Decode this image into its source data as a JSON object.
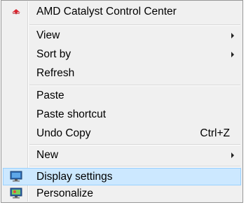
{
  "context_menu": {
    "items": [
      {
        "label": "AMD Catalyst Control Center",
        "icon": "amd-catalyst-icon"
      },
      {
        "label": "View",
        "submenu": true
      },
      {
        "label": "Sort by",
        "submenu": true
      },
      {
        "label": "Refresh"
      },
      {
        "label": "Paste"
      },
      {
        "label": "Paste shortcut"
      },
      {
        "label": "Undo Copy",
        "shortcut": "Ctrl+Z"
      },
      {
        "label": "New",
        "submenu": true
      },
      {
        "label": "Display settings",
        "icon": "display-settings-icon",
        "highlighted": true
      },
      {
        "label": "Personalize",
        "icon": "personalize-icon"
      }
    ]
  },
  "colors": {
    "menu_background": "#f0f0f0",
    "highlight_background": "#cce8ff",
    "highlight_border": "#99d1ff",
    "amd_brand": "#d9232e"
  }
}
